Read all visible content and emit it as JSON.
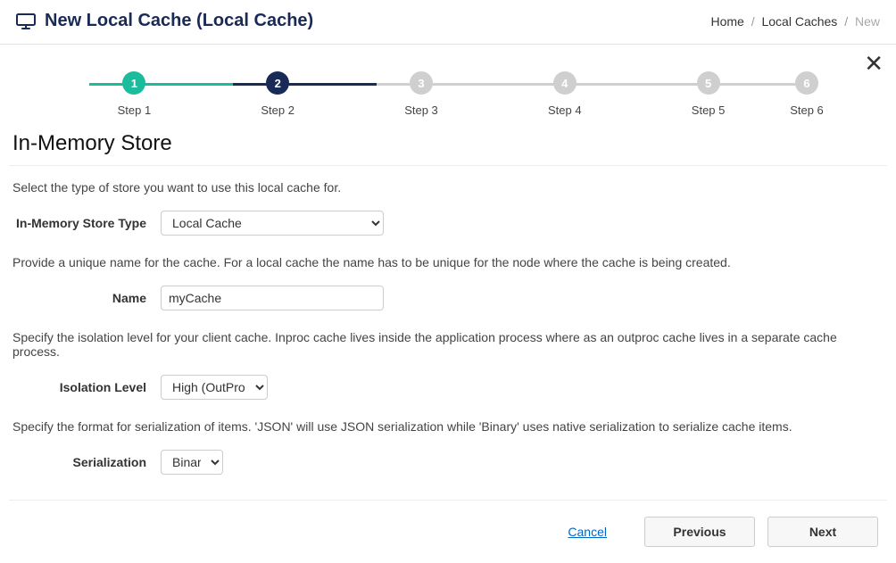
{
  "header": {
    "title": "New Local Cache (Local Cache)"
  },
  "breadcrumb": {
    "home": "Home",
    "local_caches": "Local Caches",
    "current": "New"
  },
  "stepper": {
    "steps": [
      {
        "num": "1",
        "label": "Step 1",
        "state": "done"
      },
      {
        "num": "2",
        "label": "Step 2",
        "state": "current"
      },
      {
        "num": "3",
        "label": "Step 3",
        "state": "future"
      },
      {
        "num": "4",
        "label": "Step 4",
        "state": "future"
      },
      {
        "num": "5",
        "label": "Step 5",
        "state": "future"
      },
      {
        "num": "6",
        "label": "Step 6",
        "state": "future"
      }
    ]
  },
  "section": {
    "title": "In-Memory Store",
    "store_type_help": "Select the type of store you want to use this local cache for.",
    "store_type_label": "In-Memory Store Type",
    "store_type_value": "Local Cache",
    "store_type_options": [
      "Local Cache"
    ],
    "name_help": "Provide a unique name for the cache. For a local cache the name has to be unique for the node where the cache is being created.",
    "name_label": "Name",
    "name_value": "myCache",
    "isolation_help": "Specify the isolation level for your client cache. Inproc cache lives inside the application process where as an outproc cache lives in a separate cache process.",
    "isolation_label": "Isolation Level",
    "isolation_value": "High (OutProc)",
    "isolation_options": [
      "High (OutProc)"
    ],
    "serialization_help": "Specify the format for serialization of items. 'JSON' will use JSON serialization while 'Binary' uses native serialization to serialize cache items.",
    "serialization_label": "Serialization",
    "serialization_value": "Binary",
    "serialization_options": [
      "Binary"
    ]
  },
  "footer": {
    "cancel": "Cancel",
    "previous": "Previous",
    "next": "Next"
  }
}
